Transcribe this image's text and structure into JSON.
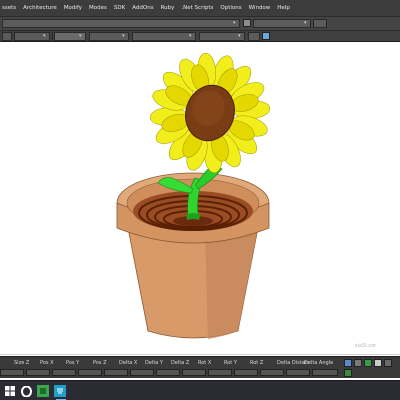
{
  "menubar": {
    "items": [
      "ssets",
      "Architecture",
      "Modify",
      "Modes",
      "SDK",
      "AddOns",
      "Ruby",
      ".Net Scripts",
      "Options",
      "Window",
      "Help"
    ]
  },
  "bottom_fields": {
    "labels": [
      "Size Z",
      "Pos X",
      "Pos Y",
      "Pos Z",
      "Delta X",
      "Delta Y",
      "Delta Z",
      "Rot X",
      "Rot Y",
      "Rot Z",
      "Delta Distanc",
      "Delta Angle"
    ]
  },
  "viewport": {
    "watermark": "sixSI.cor"
  },
  "colors": {
    "petal": "#f2ee1c",
    "seed_disc": "#7a3c14",
    "stem": "#2fd42f",
    "pot": "#d89a6a",
    "pot_shade": "#b9784a",
    "soil": "#6b2a0e",
    "chrome_dark": "#3c3c3c"
  },
  "icons": {
    "taskbar": [
      "windows-icon",
      "opera-icon",
      "app-green-icon",
      "app-blue-icon"
    ],
    "status_right": [
      "status-icon-1",
      "status-icon-2",
      "status-icon-3",
      "status-icon-4",
      "status-icon-5",
      "status-icon-6"
    ]
  }
}
